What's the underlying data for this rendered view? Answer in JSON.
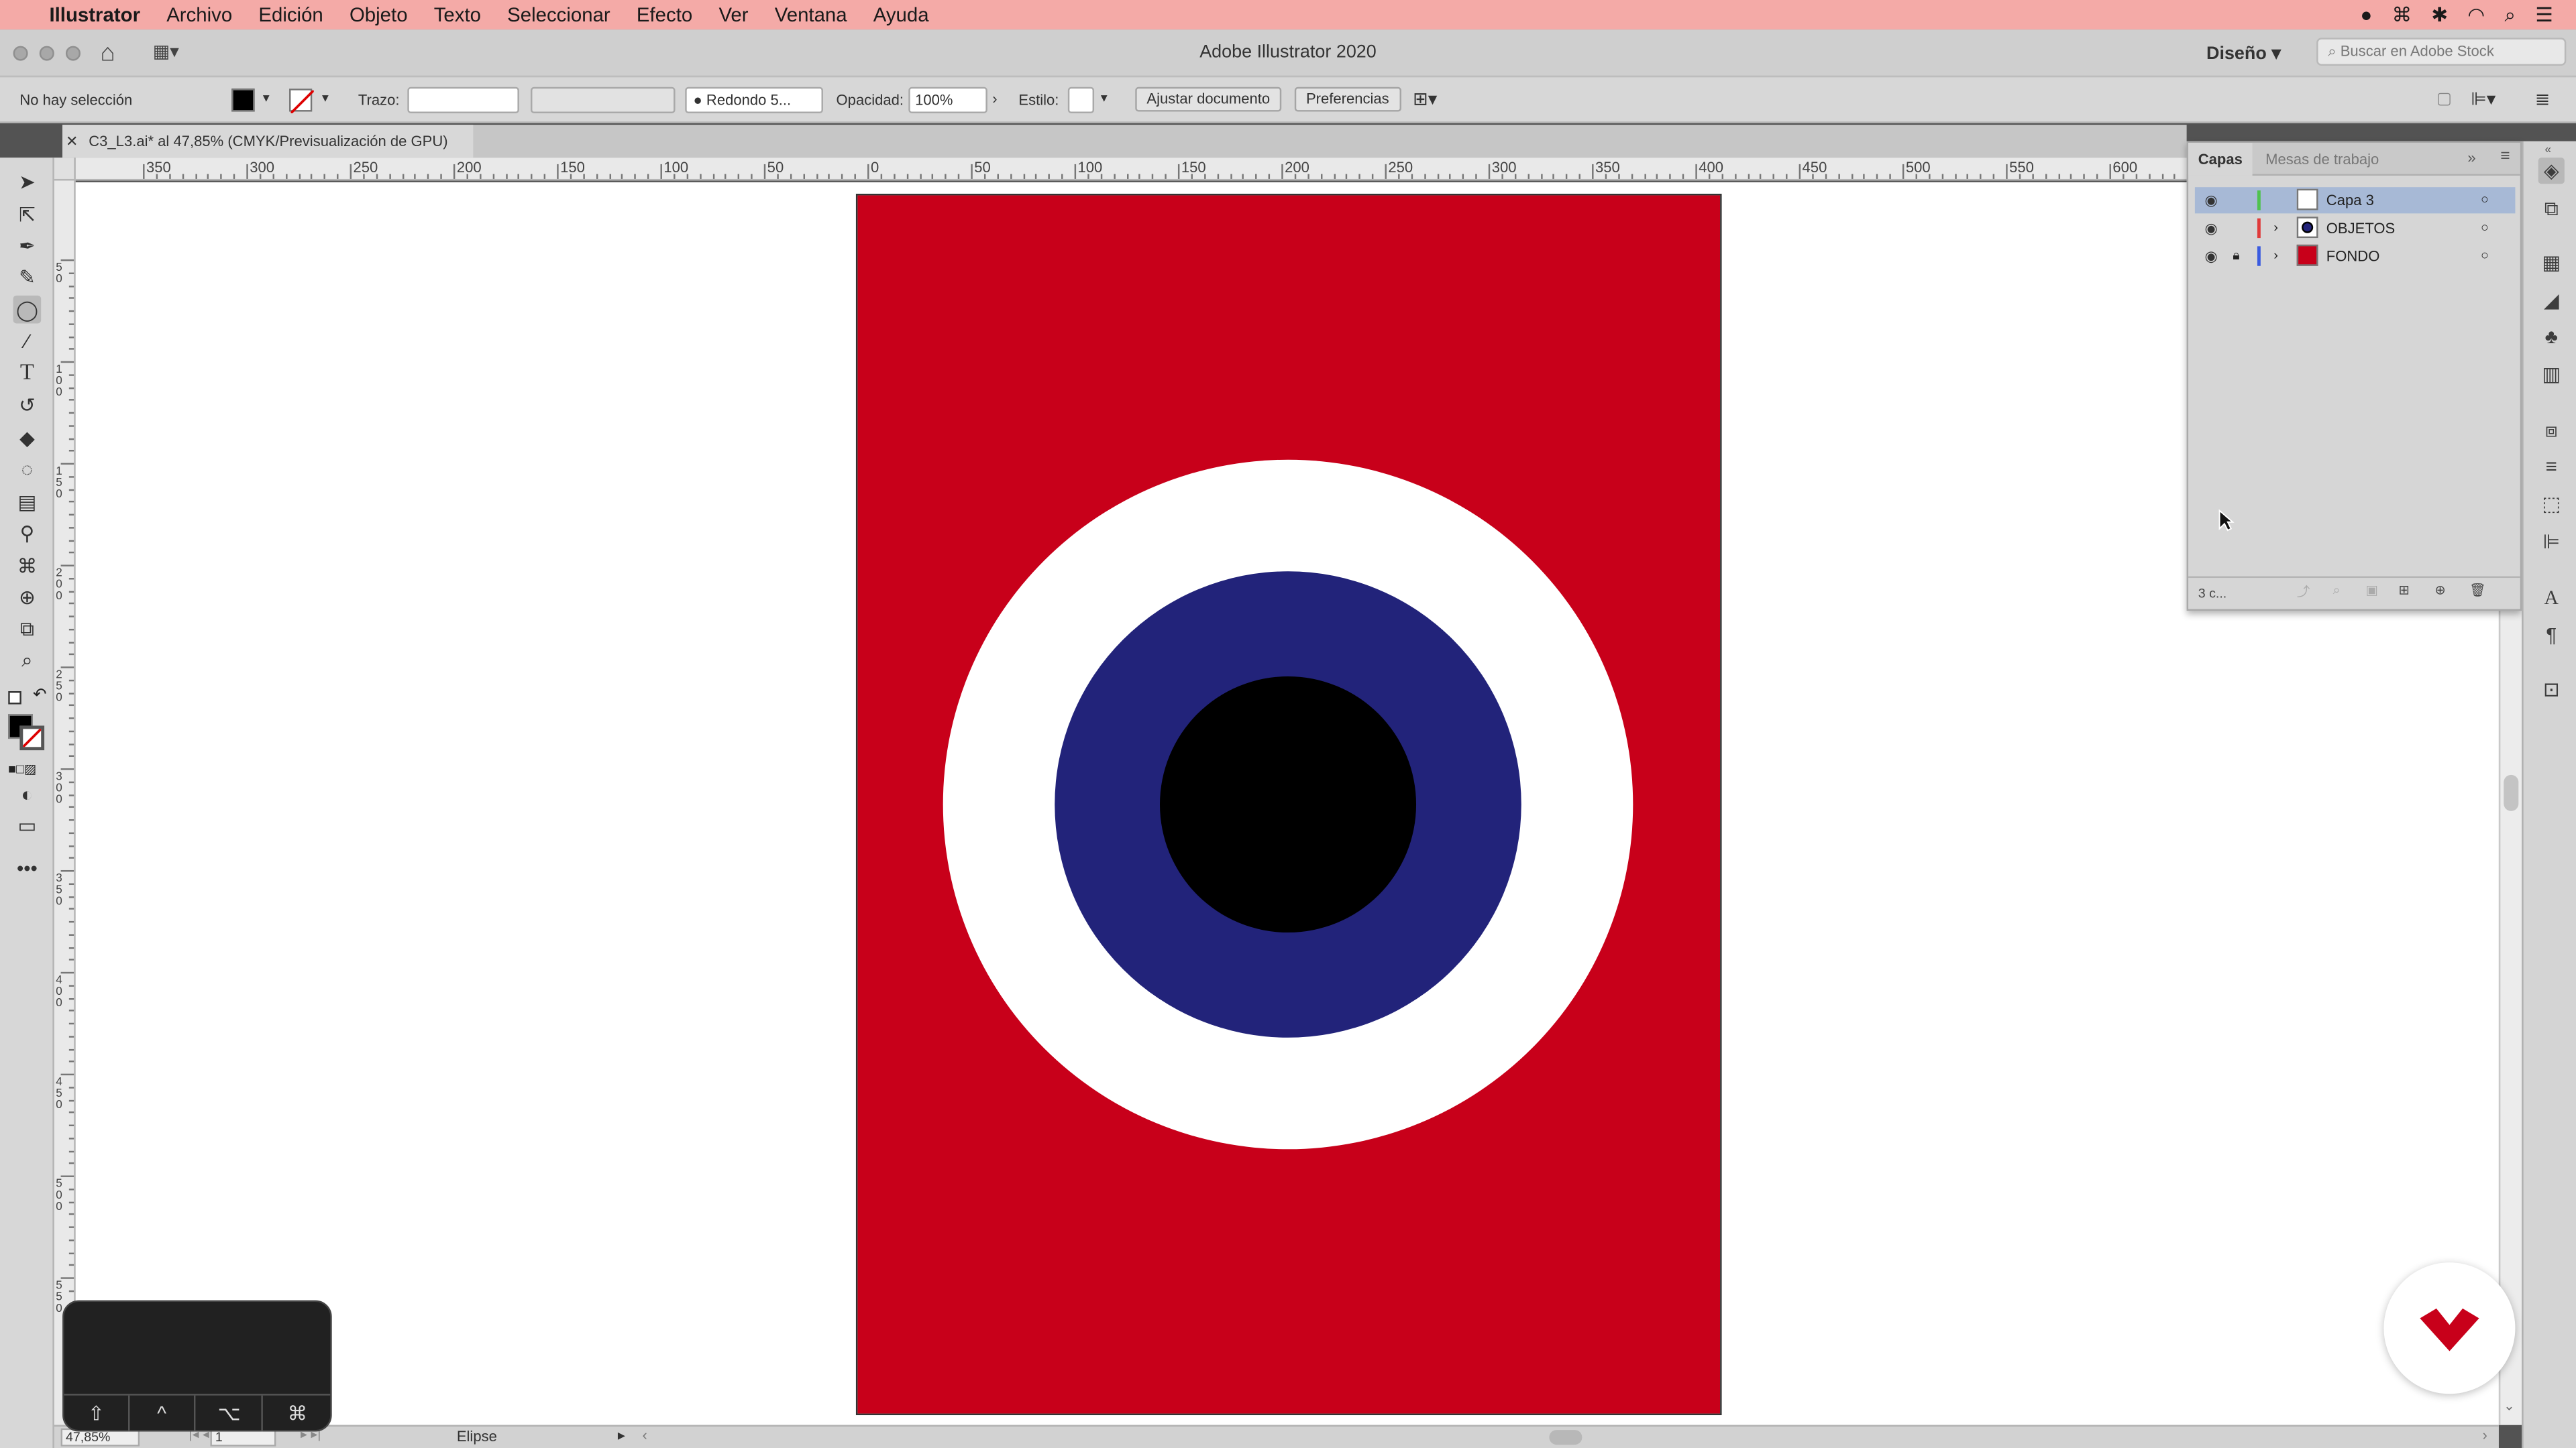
{
  "menubar": {
    "app": "Illustrator",
    "items": [
      "Archivo",
      "Edición",
      "Objeto",
      "Texto",
      "Seleccionar",
      "Efecto",
      "Ver",
      "Ventana",
      "Ayuda"
    ]
  },
  "titlebar": {
    "title": "Adobe Illustrator 2020",
    "workspace": "Diseño",
    "stock_placeholder": "Buscar en Adobe Stock"
  },
  "control": {
    "selection": "No hay selección",
    "stroke_label": "Trazo:",
    "brush": "Redondo 5...",
    "opacity_label": "Opacidad:",
    "opacity_value": "100%",
    "style_label": "Estilo:",
    "fit_button": "Ajustar documento",
    "prefs_button": "Preferencias"
  },
  "document": {
    "tab_label": "C3_L3.ai* al 47,85% (CMYK/Previsualización de GPU)"
  },
  "rulers": {
    "h_labels": [
      "350",
      "300",
      "250",
      "200",
      "150",
      "100",
      "50",
      "0",
      "50",
      "100",
      "150",
      "200",
      "250",
      "300",
      "350",
      "400",
      "450",
      "500",
      "550",
      "600"
    ],
    "v_labels": [
      "50",
      "100",
      "150",
      "200",
      "250",
      "300",
      "350",
      "400",
      "450",
      "500",
      "550"
    ]
  },
  "layers_panel": {
    "tabs": [
      "Capas",
      "Mesas de trabajo"
    ],
    "layers": [
      {
        "name": "Capa 3",
        "color": "#4fc24f"
      },
      {
        "name": "OBJETOS",
        "color": "#e03a3a"
      },
      {
        "name": "FONDO",
        "color": "#3a5be0"
      }
    ],
    "footer": "3 c..."
  },
  "artwork": {
    "background": "#c8001a",
    "ring_outer": "#ffffff",
    "ring_middle": "#22237a",
    "center": "#000000"
  },
  "status": {
    "zoom": "47,85%",
    "artboard": "1",
    "tool": "Elipse"
  },
  "keywidget": {
    "keys": [
      "⇧",
      "^",
      "⌥",
      "⌘"
    ]
  }
}
